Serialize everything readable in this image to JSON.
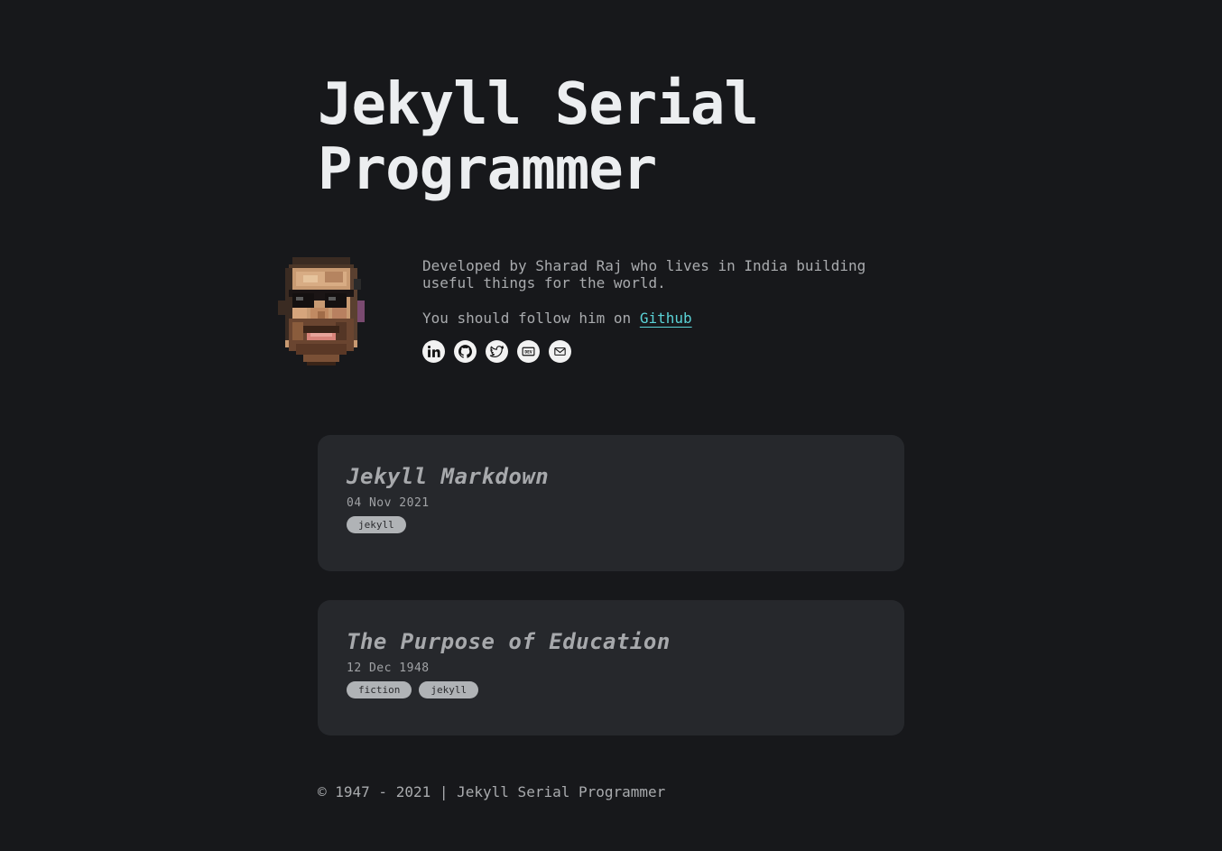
{
  "site": {
    "title": "Jekyll Serial Programmer"
  },
  "author": {
    "bio": "Developed by Sharad Raj who lives in India building useful things for the world.",
    "follow_prefix": "You should follow him on ",
    "follow_link_label": "Github"
  },
  "socials": [
    {
      "icon": "linkedin-icon"
    },
    {
      "icon": "github-icon"
    },
    {
      "icon": "twitter-icon"
    },
    {
      "icon": "dev-icon"
    },
    {
      "icon": "mail-icon"
    }
  ],
  "posts": [
    {
      "title": "Jekyll Markdown",
      "date": "04 Nov 2021",
      "tags": [
        "jekyll"
      ]
    },
    {
      "title": "The Purpose of Education",
      "date": "12 Dec 1948",
      "tags": [
        "fiction",
        "jekyll"
      ]
    }
  ],
  "footer": {
    "text": "© 1947 - 2021 | Jekyll Serial Programmer"
  },
  "colors": {
    "background": "#17181b",
    "card": "#26282c",
    "link": "#5ad2d6",
    "title": "#eceef0"
  }
}
